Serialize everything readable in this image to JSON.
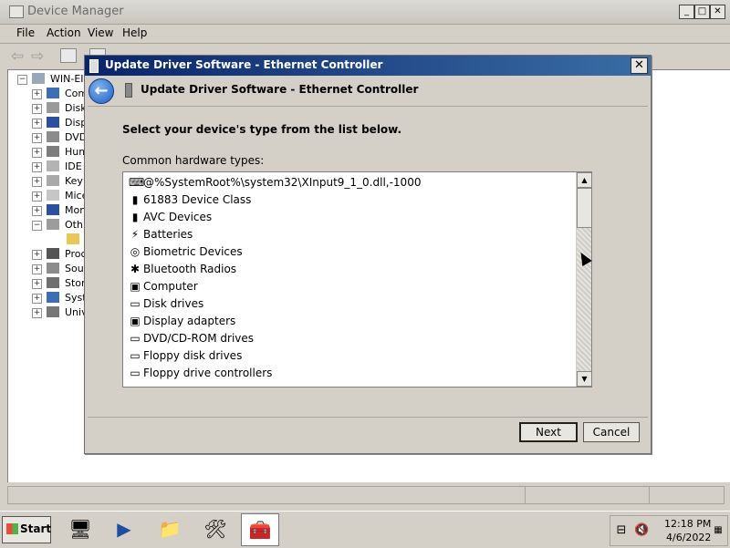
{
  "device_manager": {
    "title": "Device Manager",
    "menu": [
      "File",
      "Action",
      "View",
      "Help"
    ],
    "tree": {
      "root": "WIN-EIC",
      "items": [
        "Com",
        "Disk",
        "Disp",
        "DVD",
        "Hum",
        "IDE",
        "Key",
        "Mice",
        "Mon",
        "Oth",
        "Proc",
        "Sou",
        "Stor",
        "Syst",
        "Univ"
      ]
    }
  },
  "dialog": {
    "title": "Update Driver Software - Ethernet Controller",
    "header_title": "Update Driver Software - Ethernet Controller",
    "prompt": "Select your device's type from the list below.",
    "list_label": "Common hardware types:",
    "items": [
      {
        "label": "@%SystemRoot%\\system32\\XInput9_1_0.dll,-1000",
        "icon": "gamepad-icon",
        "glyph": "⌨"
      },
      {
        "label": "61883 Device Class",
        "icon": "device-class-icon",
        "glyph": "▮"
      },
      {
        "label": "AVC Devices",
        "icon": "avc-icon",
        "glyph": "▮"
      },
      {
        "label": "Batteries",
        "icon": "battery-icon",
        "glyph": "⚡"
      },
      {
        "label": "Biometric Devices",
        "icon": "fingerprint-icon",
        "glyph": "◎"
      },
      {
        "label": "Bluetooth Radios",
        "icon": "bluetooth-icon",
        "glyph": "✱"
      },
      {
        "label": "Computer",
        "icon": "computer-icon",
        "glyph": "▣"
      },
      {
        "label": "Disk drives",
        "icon": "disk-icon",
        "glyph": "▭"
      },
      {
        "label": "Display adapters",
        "icon": "display-icon",
        "glyph": "▣"
      },
      {
        "label": "DVD/CD-ROM drives",
        "icon": "dvd-icon",
        "glyph": "▭"
      },
      {
        "label": "Floppy disk drives",
        "icon": "floppy-icon",
        "glyph": "▭"
      },
      {
        "label": "Floppy drive controllers",
        "icon": "floppy-controller-icon",
        "glyph": "▭"
      }
    ],
    "next_label": "Next",
    "cancel_label": "Cancel"
  },
  "taskbar": {
    "start_label": "Start",
    "time": "12:18 PM",
    "date": "4/6/2022"
  }
}
